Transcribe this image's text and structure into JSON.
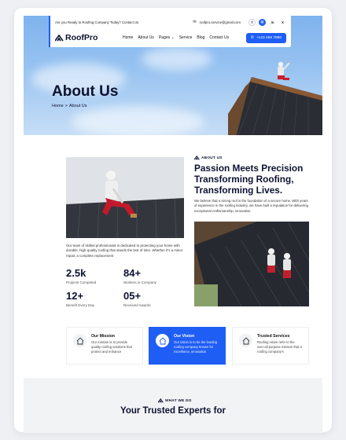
{
  "topbar": {
    "tagline": "Are you Ready to Roofing Company Today? Contact Us",
    "email": "roofpro.service@gmail.com",
    "socials": [
      "f",
      "◎",
      "in",
      "X"
    ]
  },
  "navbar": {
    "logo_text": "RoofPro",
    "links": [
      "Home",
      "About Us",
      "Pages",
      "Service",
      "Blog",
      "Contact Us"
    ],
    "pages_chevron": "⌄",
    "phone": "+123 456 7890"
  },
  "hero": {
    "title": "About Us",
    "breadcrumb": [
      "Home",
      "About Us"
    ],
    "separator": ">"
  },
  "about": {
    "eyebrow": "ABOUT US",
    "heading": "Passion Meets Precision Transforming Roofing, Transforming Lives.",
    "paragraph": "We believe that a strong roof is the foundation of a secure home. With years of experience in the roofing industry, we have built a reputation for delivering exceptional craftsmanship, innovative.",
    "intro": "Our team of skilled professionals is dedicated to protecting your home with durable, high-quality roofing that stands the test of time. Whether it's a minor repair, a complete replacement",
    "stats": [
      {
        "num": "2.5k",
        "label": "Projects Competed"
      },
      {
        "num": "84+",
        "label": "Workers in Company"
      },
      {
        "num": "12+",
        "label": "Benefit Every Day"
      },
      {
        "num": "05+",
        "label": "Received Awards"
      }
    ]
  },
  "cards": [
    {
      "title": "Our Mission",
      "body": "Our mission is to provide quality roofing solutions that protect and enhance"
    },
    {
      "title": "Our Vision",
      "body": "Our vision is to be the leading roofing company known for excellence, innovation"
    },
    {
      "title": "Trusted Services",
      "body": "Roofing vision refer to the over all purpose mission that a roofing company's"
    }
  ],
  "services": {
    "eyebrow": "WHAT WE DO",
    "title": "Your Trusted Experts for"
  },
  "colors": {
    "accent": "#1f5ef5",
    "navy": "#0d1230"
  }
}
